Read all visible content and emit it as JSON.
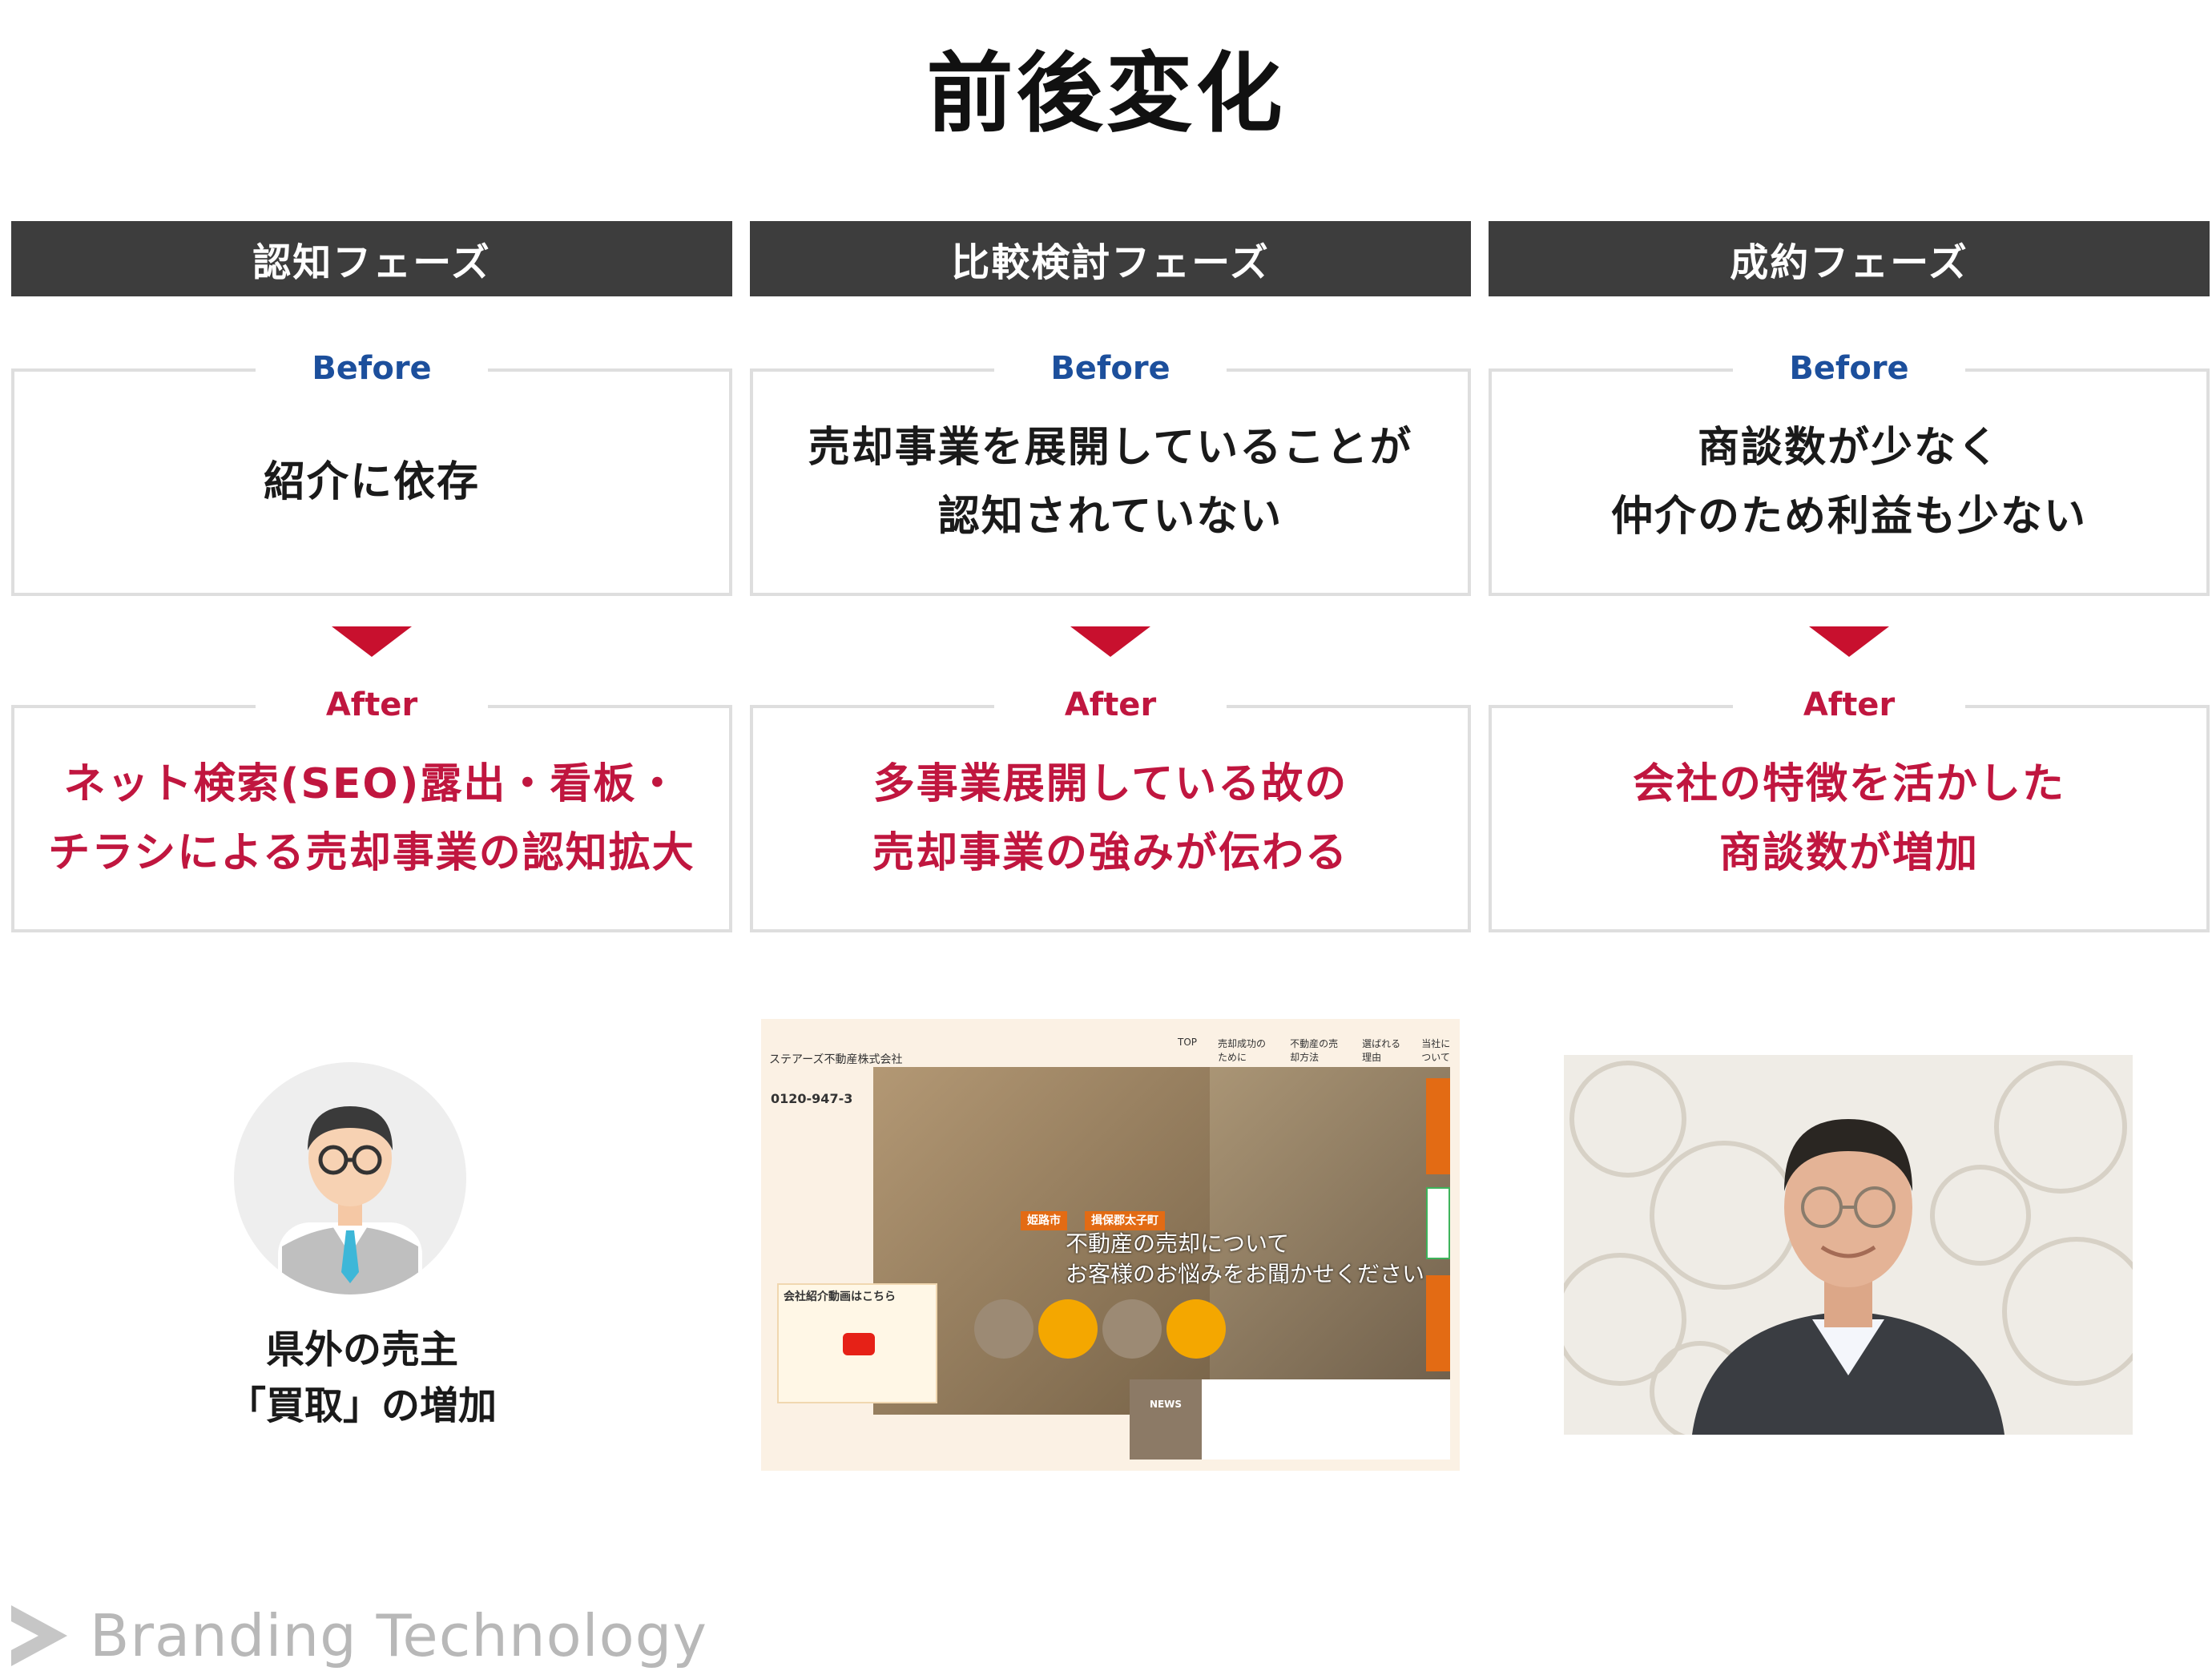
{
  "title": "前後変化",
  "before_label": "Before",
  "after_label": "After",
  "columns": [
    {
      "phase": "認知フェーズ",
      "before": "紹介に依存",
      "after": "ネット検索(SEO)露出・看板・\nチラシによる売却事業の認知拡大"
    },
    {
      "phase": "比較検討フェーズ",
      "before": "売却事業を展開していることが\n認知されていない",
      "after": "多事業展開している故の\n売却事業の強みが伝わる"
    },
    {
      "phase": "成約フェーズ",
      "before": "商談数が少なく\n仲介のため利益も少ない",
      "after": "会社の特徴を活かした\n商談数が増加"
    }
  ],
  "avatar_caption": "県外の売主\n「買取」の増加",
  "website": {
    "logo": "ステアーズ不動産株式会社",
    "tel": "0120-947-3",
    "nav": [
      "TOP",
      "売却成功のために",
      "不動産の売却方法",
      "選ばれる理由",
      "当社について"
    ],
    "badges": [
      "姫路市",
      "揖保郡太子町"
    ],
    "copy": "不動産の売却について\nお客様のお悩みをお聞かせください",
    "video_label": "会社紹介動画はこちら",
    "news_label": "NEWS"
  },
  "footer": "Branding Technology"
}
